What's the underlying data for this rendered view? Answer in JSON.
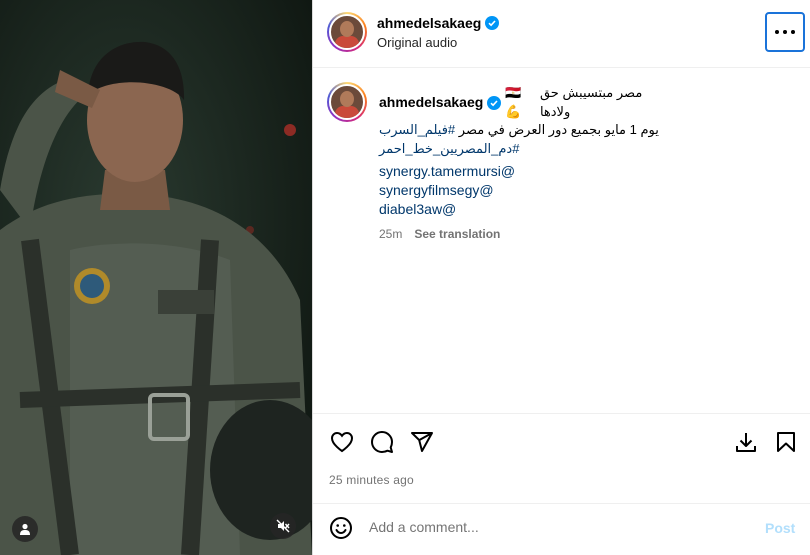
{
  "post": {
    "username": "ahmedelsakaeg",
    "audio": "Original audio",
    "more_icon": "more-horizontal-icon"
  },
  "caption": {
    "username": "ahmedelsakaeg",
    "line1_text": "مصر مبتسيبش حق ولادها",
    "line1_emojis": "🇪🇬💪",
    "hashtag1": "#فيلم_السرب",
    "line2_text": "يوم 1 مايو بجميع دور العرض في مصر",
    "hashtag2": "#دم_المصريين_خط_احمر",
    "mentions": [
      "synergy.tamermursi@",
      "synergyfilmsegy@",
      "diabel3aw@"
    ],
    "age": "25m",
    "see_translation": "See translation"
  },
  "actions": {
    "like_icon": "heart-icon",
    "comment_icon": "comment-icon",
    "share_icon": "send-icon",
    "download_icon": "download-icon",
    "save_icon": "bookmark-icon",
    "timestamp": "25 minutes ago"
  },
  "comment_box": {
    "placeholder": "Add a comment...",
    "post_label": "Post"
  },
  "media": {
    "tag_icon": "user-tag-icon",
    "mute_icon": "muted-speaker-icon"
  },
  "colors": {
    "link": "#00376b",
    "verified": "#0095f6",
    "post_disabled": "#b2dffc",
    "focus_ring": "#1a73d9"
  }
}
